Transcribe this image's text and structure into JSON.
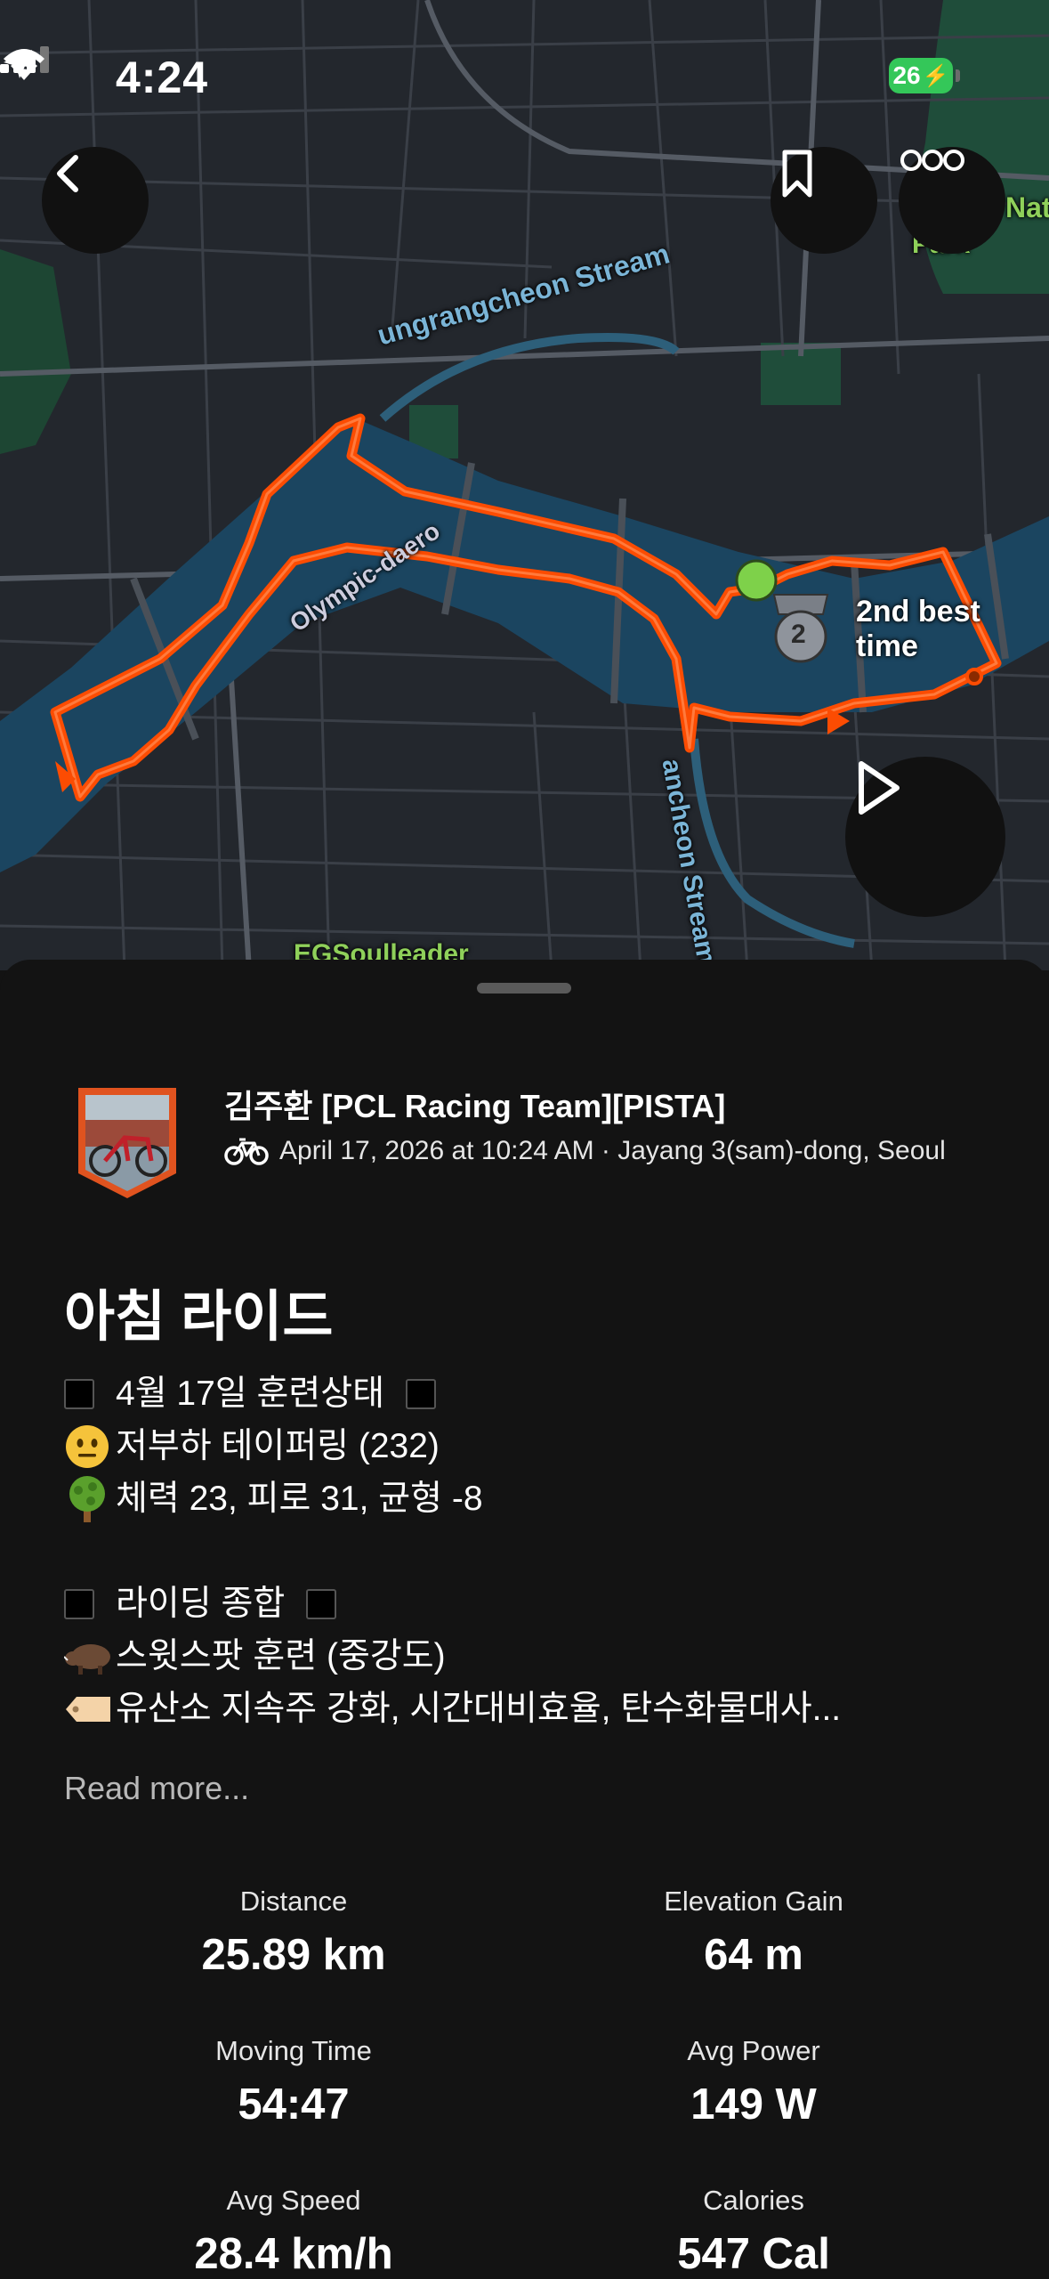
{
  "status_bar": {
    "time": "4:24",
    "battery": "26"
  },
  "map": {
    "labels": {
      "stream_top": "ungrangcheon Stream",
      "road": "Olympic-daero",
      "stream_bottom": "ancheon Stream",
      "place_bottom": "EGSoulleader",
      "park": "Nat",
      "park2": "Park"
    },
    "segment_label": "2nd best time",
    "medal_rank": "2",
    "colors": {
      "route": "#fc4c02",
      "river": "#1b4560",
      "land": "#23272d",
      "start_dot": "#7ed14a"
    }
  },
  "activity": {
    "athlete_name": "김주환 [PCL Racing Team][PISTA]",
    "meta": "April 17, 2026 at 10:24 AM · Jayang 3(sam)-dong, Seoul",
    "title": "아침 라이드",
    "description": [
      "4월 17일 훈련상태",
      "저부하 테이퍼링 (232)",
      "체력 23, 피로 31, 균형 -8",
      "",
      "라이딩 종합",
      "스윗스팟 훈련 (중강도)",
      "유산소 지속주 강화, 시간대비효율, 탄수화물대사..."
    ],
    "description_icons": [
      "black-square",
      "neutral-face",
      "tree",
      "",
      "black-square",
      "boar",
      "label-tag"
    ],
    "read_more": "Read more..."
  },
  "stats": [
    {
      "label": "Distance",
      "value": "25.89 km"
    },
    {
      "label": "Elevation Gain",
      "value": "64 m"
    },
    {
      "label": "Moving Time",
      "value": "54:47"
    },
    {
      "label": "Avg Power",
      "value": "149 W"
    },
    {
      "label": "Avg Speed",
      "value": "28.4 km/h"
    },
    {
      "label": "Calories",
      "value": "547 Cal"
    }
  ]
}
